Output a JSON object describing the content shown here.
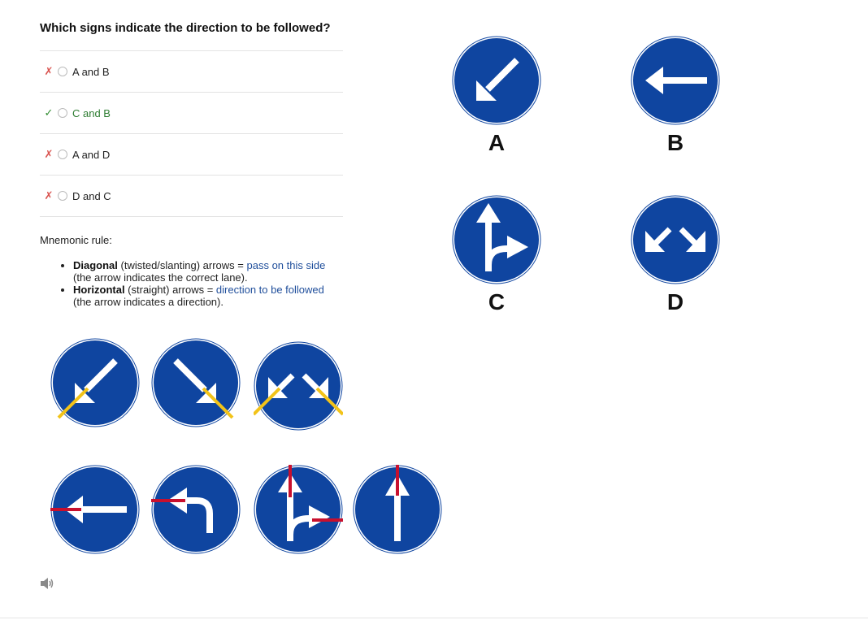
{
  "question": "Which signs indicate the direction to be followed?",
  "options": [
    {
      "mark": "✗",
      "status": "wrong",
      "label": "A and B"
    },
    {
      "mark": "✓",
      "status": "right",
      "label": "C and B"
    },
    {
      "mark": "✗",
      "status": "wrong",
      "label": "A and D"
    },
    {
      "mark": "✗",
      "status": "wrong",
      "label": "D and C"
    }
  ],
  "mnemonic": {
    "title": "Mnemonic rule:",
    "rules": [
      {
        "bold": "Diagonal",
        "text": " (twisted/slanting) arrows = ",
        "highlight": "pass on this side",
        "note": "(the arrow indicates the correct lane)."
      },
      {
        "bold": "Horizontal",
        "text": " (straight) arrows = ",
        "highlight": "direction to be followed",
        "note": "(the arrow indicates a direction)."
      }
    ]
  },
  "signs": {
    "a": {
      "letter": "A",
      "icon": "arrow-down-left-icon"
    },
    "b": {
      "letter": "B",
      "icon": "arrow-left-icon"
    },
    "c": {
      "letter": "C",
      "icon": "arrow-straight-or-right-icon"
    },
    "d": {
      "letter": "D",
      "icon": "arrows-down-both-sides-icon"
    }
  },
  "colors": {
    "sign_blue": "#0f45a0",
    "yellow": "#f2c319",
    "red": "#c8102e",
    "correct_green": "#2e7d32",
    "wrong_red": "#d9534f",
    "link_blue": "#1f4e9b"
  }
}
